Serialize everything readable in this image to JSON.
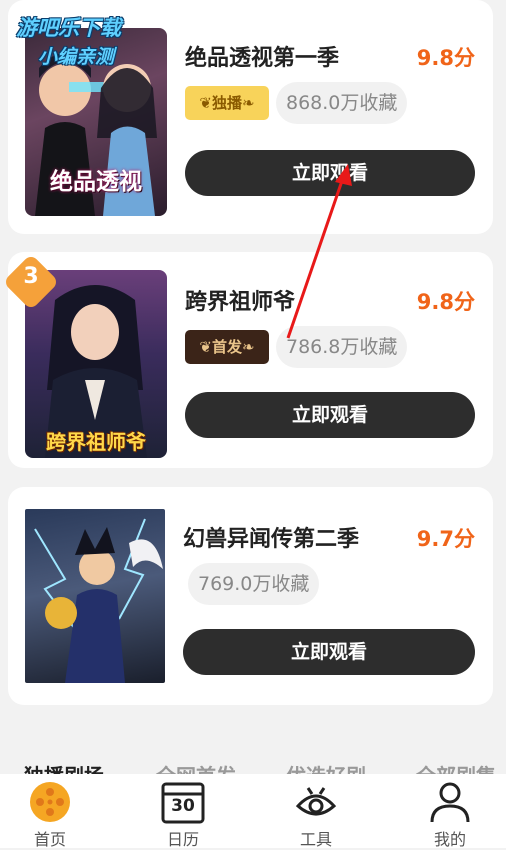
{
  "watermark": {
    "line1": "游吧乐下载",
    "line2": "小编亲测"
  },
  "items": [
    {
      "title": "绝品透视第一季",
      "score": "9.8分",
      "badge": "独播",
      "collections": "868.0万收藏",
      "button": "立即观看",
      "cover_text": "绝品透视",
      "rank": ""
    },
    {
      "title": "跨界祖师爷",
      "score": "9.8分",
      "badge": "首发",
      "collections": "786.8万收藏",
      "button": "立即观看",
      "cover_text": "跨界祖师爷",
      "rank": "3"
    },
    {
      "title": "幻兽异闻传第二季",
      "score": "9.7分",
      "badge": "",
      "collections": "769.0万收藏",
      "button": "立即观看",
      "cover_text": "",
      "rank": ""
    }
  ],
  "tabs": [
    "独播剧场",
    "全网首发",
    "优选好剧",
    "全部剧集"
  ],
  "nav": [
    {
      "label": "首页",
      "icon": "film-reel-icon",
      "active": true
    },
    {
      "label": "日历",
      "icon": "calendar-icon",
      "day": "30"
    },
    {
      "label": "工具",
      "icon": "eye-icon"
    },
    {
      "label": "我的",
      "icon": "person-icon"
    }
  ],
  "colors": {
    "accent": "#f06419",
    "button": "#2d2d2d",
    "nav_active": "#f5a623"
  }
}
